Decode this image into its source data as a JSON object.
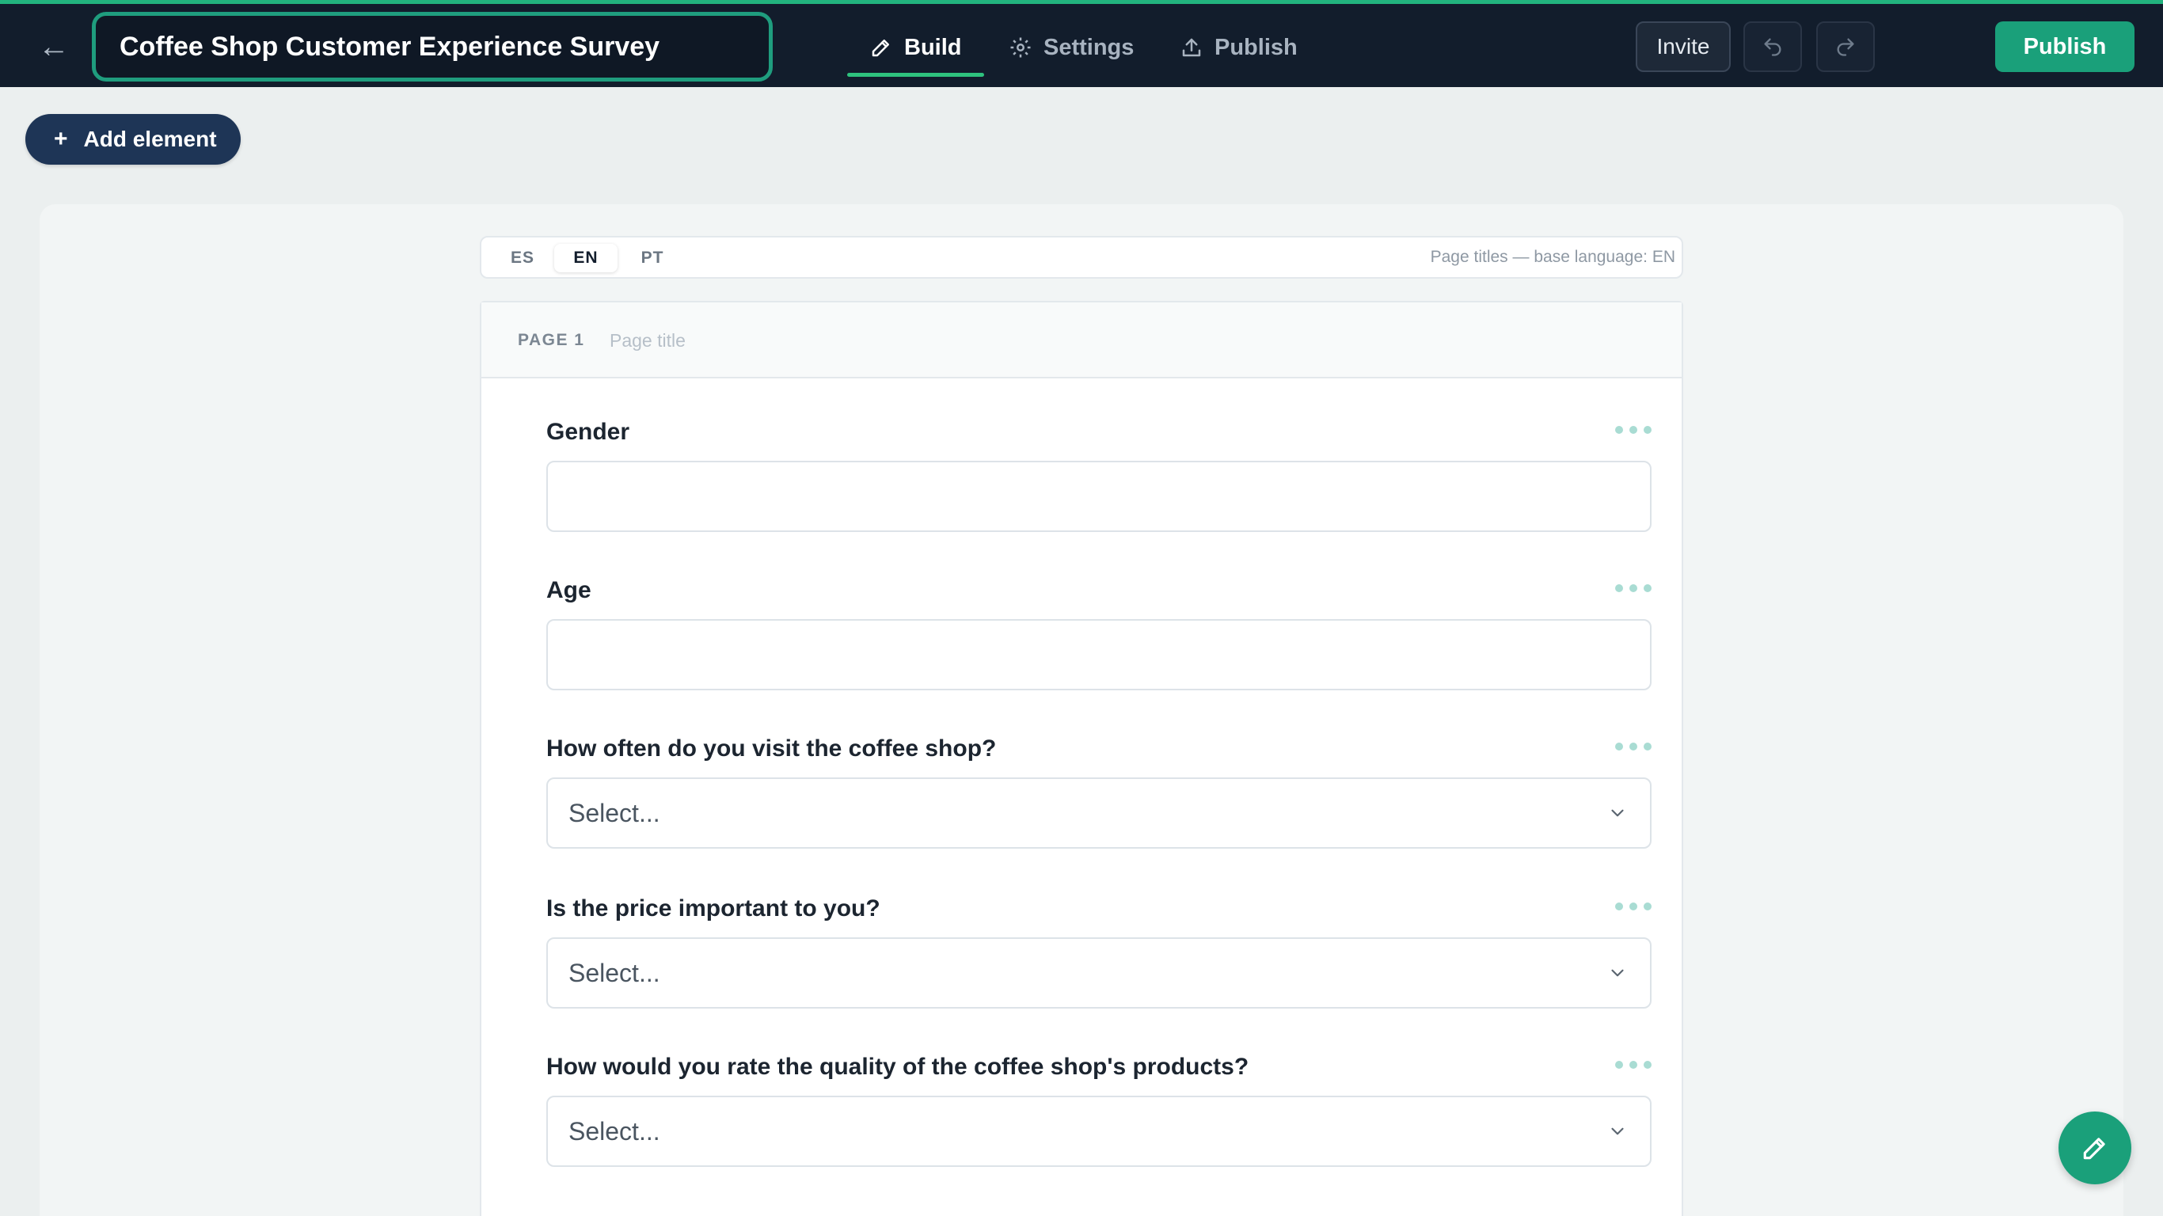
{
  "header": {
    "back_icon": "arrow-left-icon",
    "survey_title": "Coffee Shop Customer Experience Survey",
    "tabs": [
      {
        "label": "Build",
        "icon": "pencil-icon",
        "active": true
      },
      {
        "label": "Settings",
        "icon": "gear-icon",
        "active": false
      },
      {
        "label": "Publish",
        "icon": "upload-icon",
        "active": false
      }
    ],
    "invite_label": "Invite",
    "publish_label": "Publish",
    "accent_color": "#1aa07a"
  },
  "toolbar": {
    "add_element_label": "Add element"
  },
  "languages": {
    "tabs": [
      "ES",
      "EN",
      "PT"
    ],
    "active": "EN",
    "note": "Page titles — base language: EN"
  },
  "page": {
    "label": "PAGE 1",
    "title_placeholder": "Page title"
  },
  "questions": [
    {
      "label": "Gender",
      "type": "text",
      "value": ""
    },
    {
      "label": "Age",
      "type": "text",
      "value": ""
    },
    {
      "label": "How often do you visit the coffee shop?",
      "type": "select",
      "placeholder": "Select..."
    },
    {
      "label": "Is the price important to you?",
      "type": "select",
      "placeholder": "Select..."
    },
    {
      "label": "How would you rate the quality of the coffee shop's products?",
      "type": "select",
      "placeholder": "Select..."
    }
  ]
}
